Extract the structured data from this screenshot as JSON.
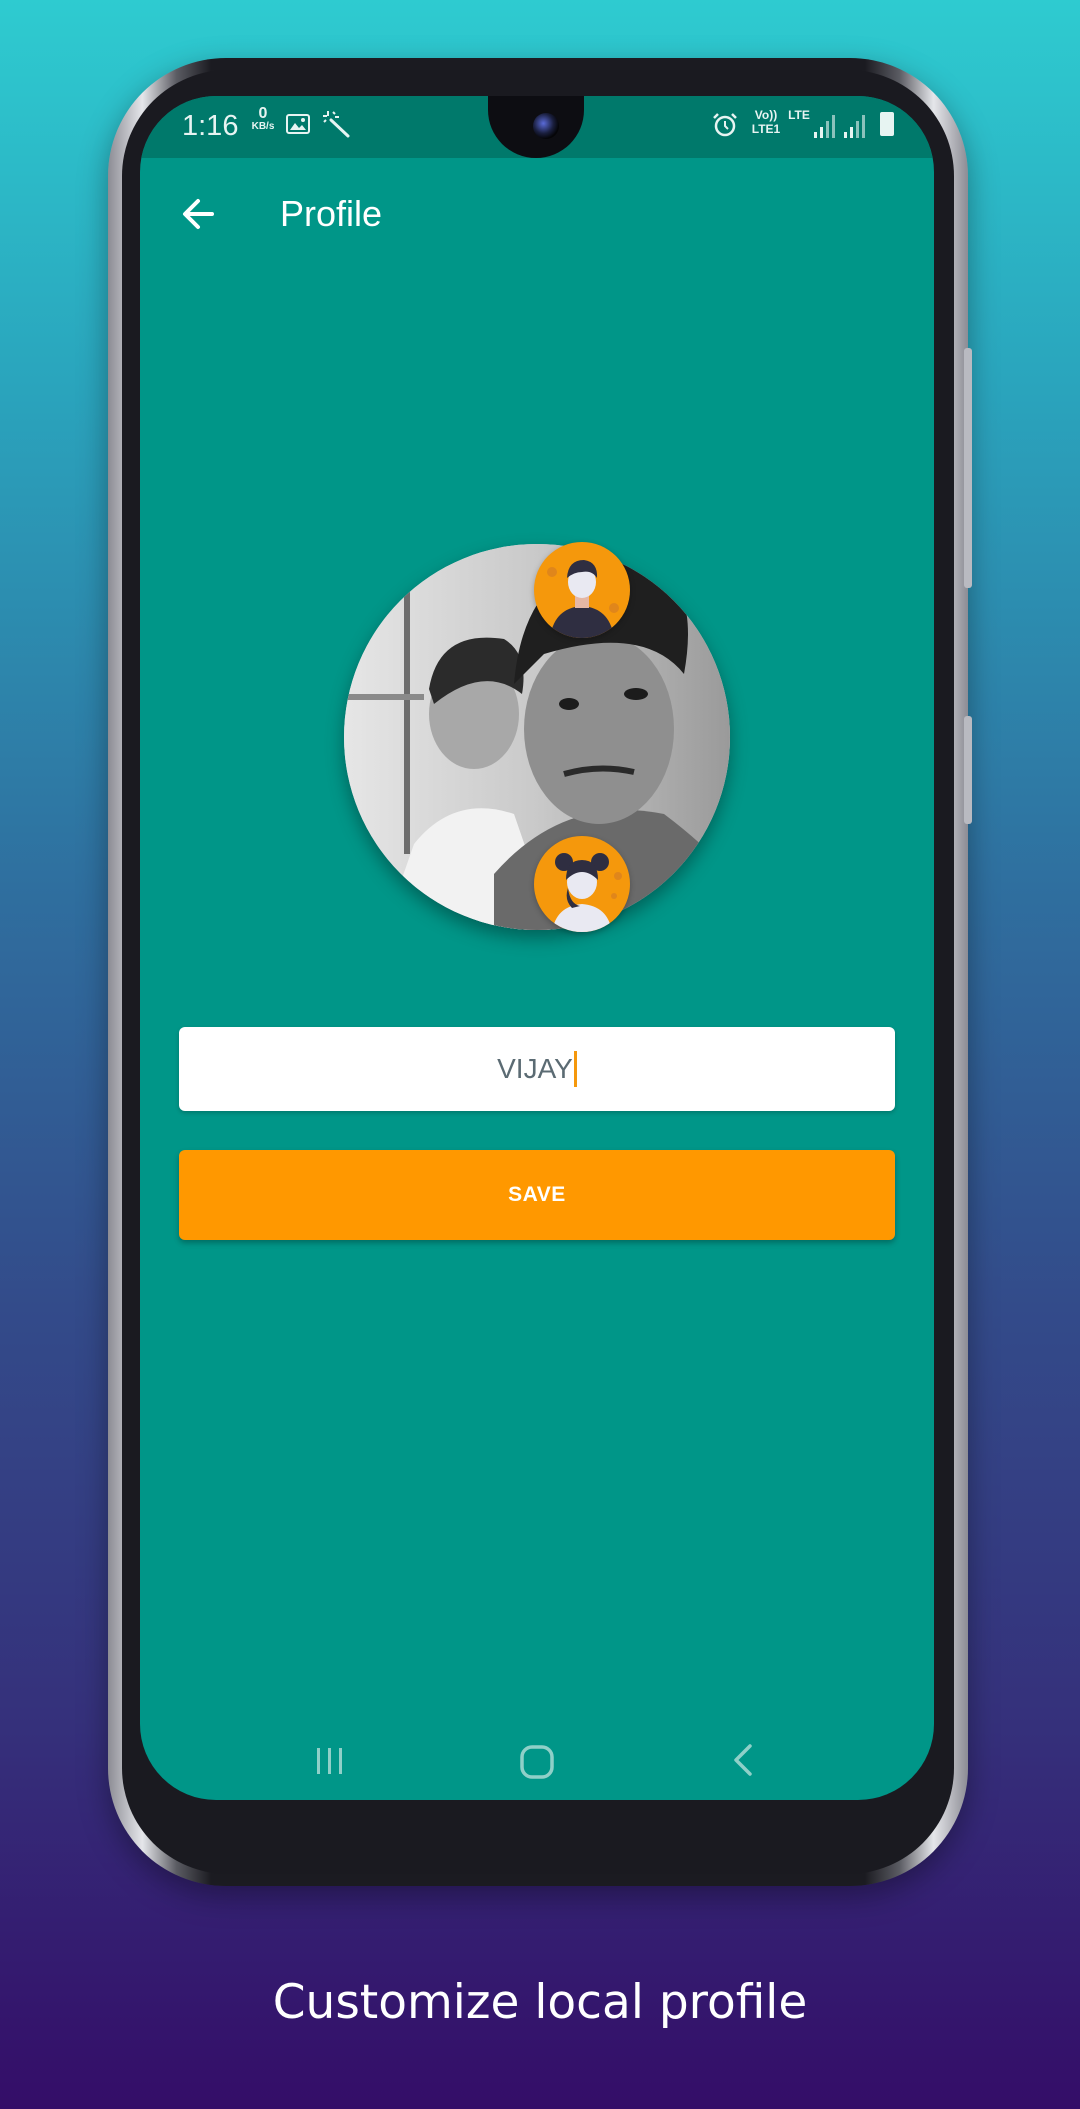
{
  "status_bar": {
    "time": "1:16",
    "net_speed_value": "0",
    "net_speed_unit": "KB/s",
    "volte_label_top": "Vo))",
    "volte_label_bottom": "LTE1",
    "lte_label": "LTE",
    "icons": [
      "image-icon",
      "magic-wand-icon",
      "alarm-icon",
      "signal-icon",
      "signal-icon",
      "battery-icon"
    ]
  },
  "app_bar": {
    "title": "Profile",
    "back_icon": "arrow-left-icon"
  },
  "profile": {
    "avatar_options": [
      "male-avatar",
      "female-avatar"
    ]
  },
  "name_input": {
    "value": "VIJAY"
  },
  "save_button": {
    "label": "SAVE"
  },
  "nav_bar": {
    "icons": [
      "recents-icon",
      "home-icon",
      "back-icon"
    ]
  },
  "caption": "Customize local profile",
  "colors": {
    "primary": "#009688",
    "primary_dark": "#00796b",
    "accent": "#ff9800",
    "background_top": "#2ecbd0",
    "background_bottom": "#340d68"
  }
}
